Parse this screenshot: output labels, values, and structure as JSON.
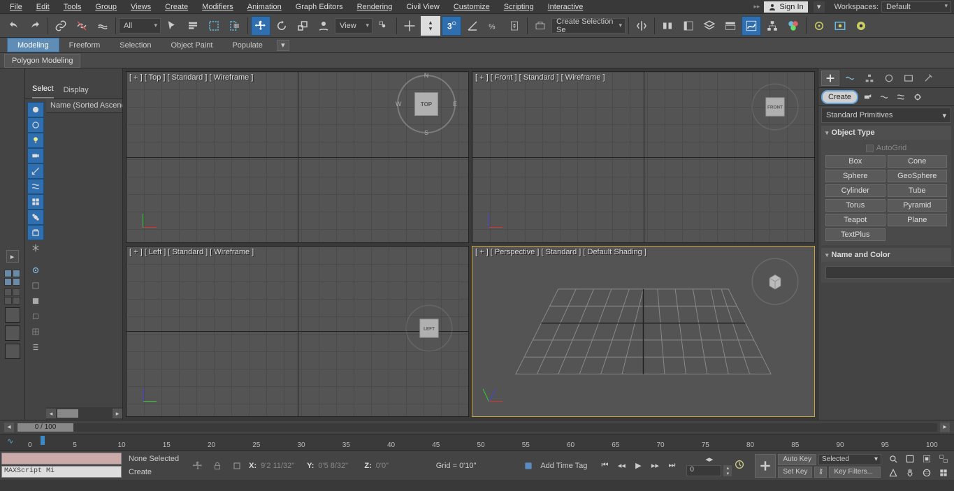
{
  "menubar": {
    "items": [
      "File",
      "Edit",
      "Tools",
      "Group",
      "Views",
      "Create",
      "Modifiers",
      "Animation",
      "Graph Editors",
      "Rendering",
      "Civil View",
      "Customize",
      "Scripting",
      "Interactive"
    ],
    "signin": "Sign In",
    "workspaces_label": "Workspaces:",
    "workspace": "Default"
  },
  "toolbar": {
    "all_filter": "All",
    "view_dd": "View",
    "named_sel": "Create Selection Se"
  },
  "ribbon": {
    "tabs": [
      "Modeling",
      "Freeform",
      "Selection",
      "Object Paint",
      "Populate"
    ],
    "sub_panel": "Polygon Modeling"
  },
  "scene_explorer": {
    "tabs": [
      "Select",
      "Display"
    ],
    "header": "Name (Sorted Ascending)"
  },
  "viewports": [
    {
      "label": "[ + ] [ Top ] [ Standard ] [ Wireframe ]",
      "cube": "TOP",
      "compass": true
    },
    {
      "label": "[ + ] [ Front ] [ Standard ] [ Wireframe ]",
      "cube": "FRONT"
    },
    {
      "label": "[ + ] [ Left ] [ Standard ] [ Wireframe ]",
      "cube": "LEFT"
    },
    {
      "label": "[ + ] [ Perspective ] [ Standard ] [ Default Shading ]",
      "cube": "",
      "persp": true,
      "active": true
    }
  ],
  "command_panel": {
    "create_label": "Create",
    "category": "Standard Primitives",
    "obj_type_header": "Object Type",
    "autogrid": "AutoGrid",
    "buttons": [
      "Box",
      "Cone",
      "Sphere",
      "GeoSphere",
      "Cylinder",
      "Tube",
      "Torus",
      "Pyramid",
      "Teapot",
      "Plane",
      "TextPlus"
    ],
    "name_color_header": "Name and Color"
  },
  "time_slider": {
    "label": "0 / 100"
  },
  "track_bar": {
    "ticks": [
      0,
      5,
      10,
      15,
      20,
      25,
      30,
      35,
      40,
      45,
      50,
      55,
      60,
      65,
      70,
      75,
      80,
      85,
      90,
      95,
      100
    ]
  },
  "status": {
    "maxscript_placeholder": "MAXScript Mi",
    "none_selected": "None Selected",
    "prompt": "Create",
    "x_label": "X:",
    "x_val": "9'2 11/32\"",
    "y_label": "Y:",
    "y_val": "0'5 8/32\"",
    "z_label": "Z:",
    "z_val": "0'0\"",
    "grid_label": "Grid = 0'10\"",
    "add_time_tag": "Add Time Tag",
    "auto_key": "Auto Key",
    "set_key": "Set Key",
    "selected": "Selected",
    "key_filters": "Key Filters...",
    "frame": "0"
  }
}
